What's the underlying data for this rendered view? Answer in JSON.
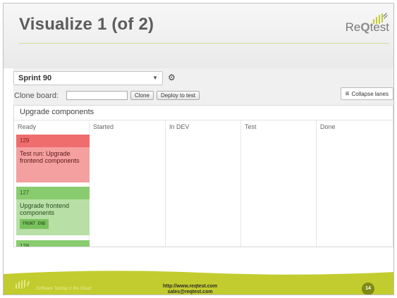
{
  "slide": {
    "title": "Visualize 1 (of 2)",
    "logo": {
      "text_prefix": "Re",
      "text_bold": "Q",
      "text_suffix": "test"
    },
    "accent_color": "#c3cc2e"
  },
  "toolbar": {
    "sprint_value": "Sprint 90",
    "clone_label": "Clone board:",
    "clone_input_value": "",
    "clone_button": "Clone",
    "deploy_button": "Deploy to test",
    "collapse_button": "Collapse lanes"
  },
  "board": {
    "title": "Upgrade components",
    "lanes": [
      "Ready",
      "Started",
      "In DEV",
      "Test",
      "Done"
    ],
    "cards": [
      {
        "id": "129",
        "title": "Test run: Upgrade frontend components",
        "color": "#ef6d6d"
      },
      {
        "id": "127",
        "title": "Upgrade frontend components",
        "tag": "FRONT END",
        "color": "#89cc70"
      },
      {
        "id": "128",
        "color": "#89cc70"
      }
    ]
  },
  "footer": {
    "tagline": "Software Testing in the Cloud",
    "url": "http://www.reqtest.com",
    "email": "sales@reqtest.com",
    "page_number": "14"
  }
}
